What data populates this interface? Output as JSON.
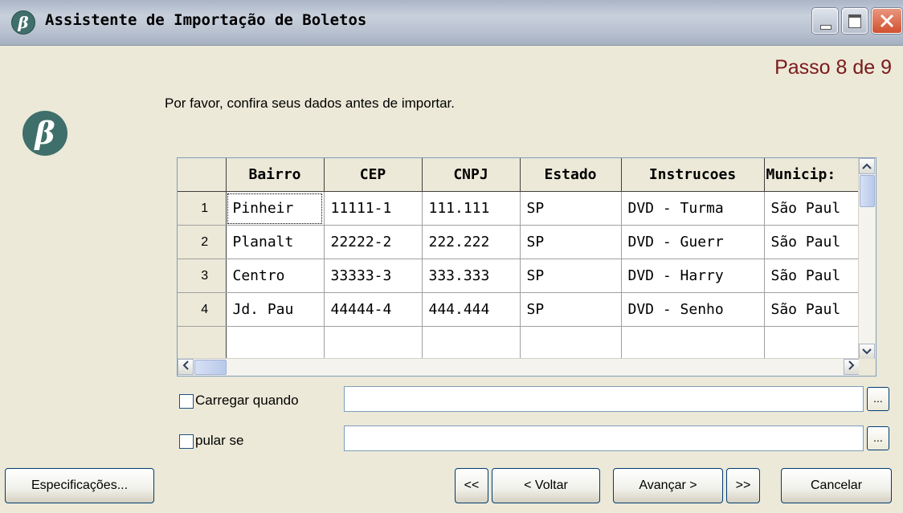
{
  "window": {
    "title": "Assistente de Importação de Boletos",
    "app_icon": "β"
  },
  "step_label": "Passo 8 de 9",
  "instruction": "Por favor, confira seus dados antes de importar.",
  "logo": "β",
  "table": {
    "columns": [
      "Bairro",
      "CEP",
      "CNPJ",
      "Estado",
      "Instrucoes",
      "Municip:"
    ],
    "rows": [
      {
        "n": "1",
        "cells": [
          "Pinheir",
          "11111-1",
          "111.111",
          "SP",
          "DVD - Turma",
          "São Paul"
        ]
      },
      {
        "n": "2",
        "cells": [
          "Planalt",
          "22222-2",
          "222.222",
          "SP",
          "DVD - Guerr",
          "São Paul"
        ]
      },
      {
        "n": "3",
        "cells": [
          "Centro",
          "33333-3",
          "333.333",
          "SP",
          "DVD - Harry",
          "São Paul"
        ]
      },
      {
        "n": "4",
        "cells": [
          "Jd. Pau",
          "44444-4",
          "444.444",
          "SP",
          "DVD - Senho",
          "São Paul"
        ]
      }
    ]
  },
  "options": {
    "load_when_label": "Carregar quando",
    "load_when_value": "",
    "skip_if_label": "pular se",
    "skip_if_value": "",
    "browse_label": "..."
  },
  "buttons": {
    "specs": "Especificações...",
    "first": "<<",
    "back": "< Voltar",
    "next": "Avançar >",
    "last": ">>",
    "cancel": "Cancelar"
  }
}
